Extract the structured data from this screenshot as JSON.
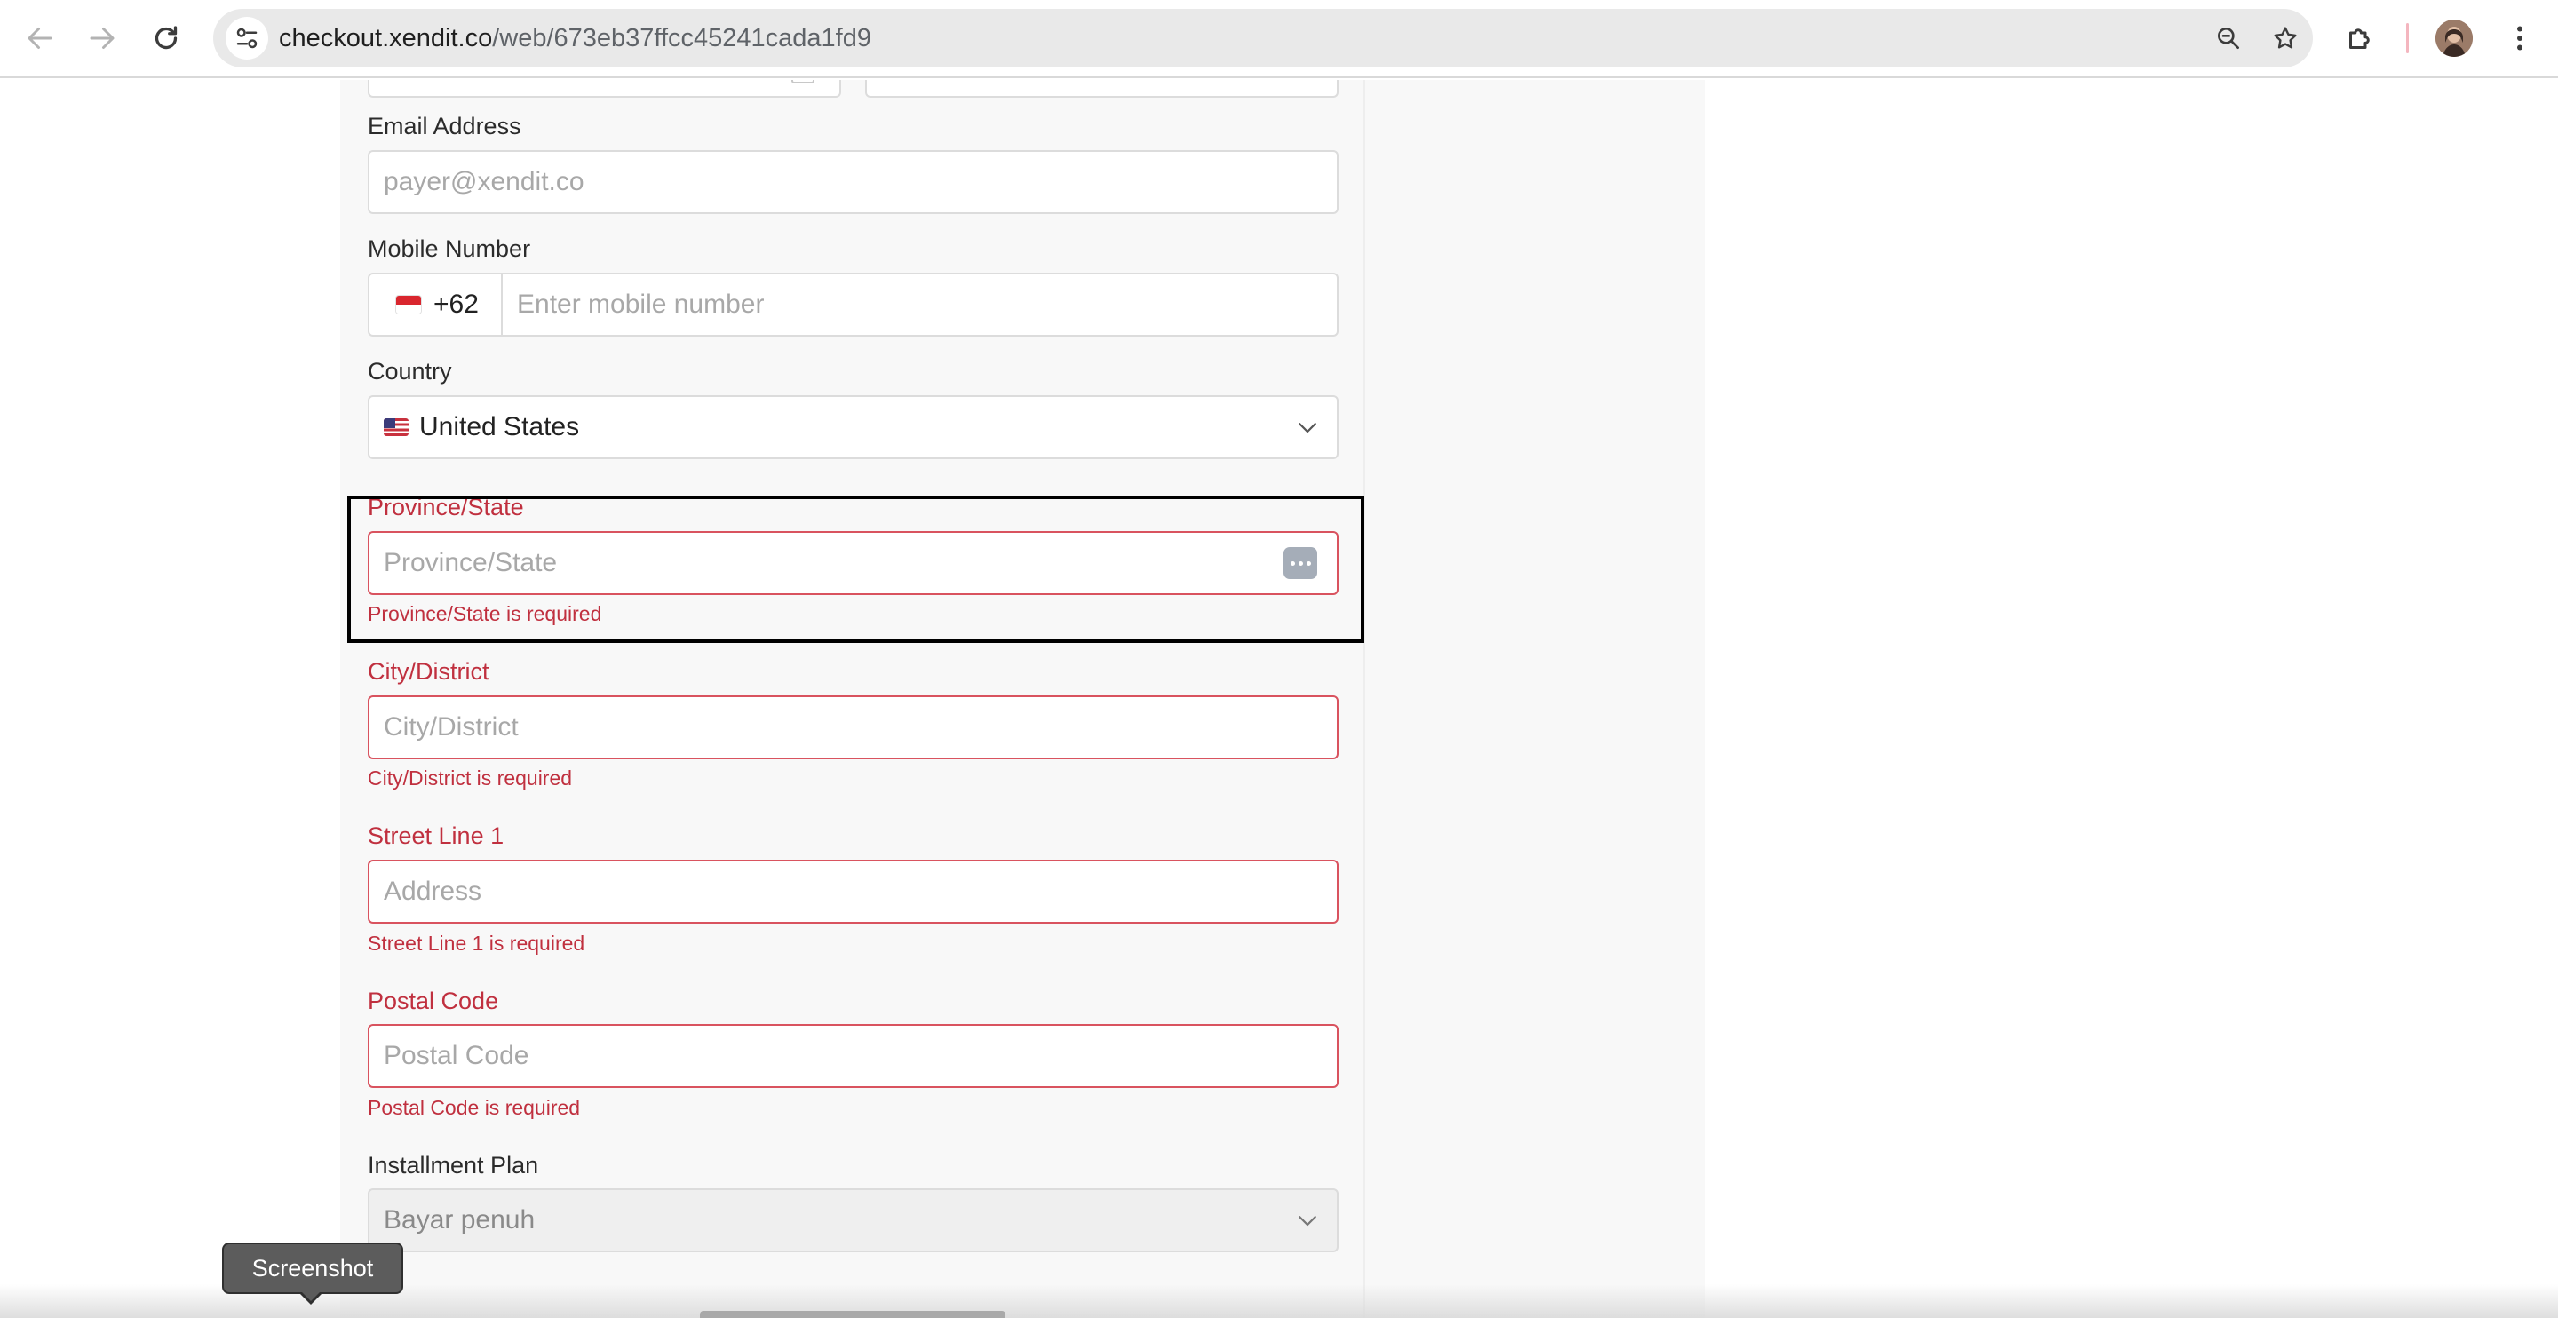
{
  "browser": {
    "url_host": "checkout.xendit.co",
    "url_path": "/web/673eb37ffcc45241cada1fd9",
    "icons": [
      "back-icon",
      "forward-icon",
      "reload-icon",
      "site-info-icon",
      "zoom-icon",
      "bookmark-star-icon",
      "extensions-icon",
      "profile-avatar",
      "more-menu-icon"
    ]
  },
  "form": {
    "email": {
      "label": "Email Address",
      "placeholder": "payer@xendit.co",
      "value": ""
    },
    "mobile": {
      "label": "Mobile Number",
      "country_code": "+62",
      "flag": "indonesia-flag-icon",
      "placeholder": "Enter mobile number",
      "value": ""
    },
    "country": {
      "label": "Country",
      "selected": "United States",
      "flag": "us-flag-icon"
    },
    "province": {
      "label": "Province/State",
      "placeholder": "Province/State",
      "value": "",
      "error": "Province/State is required"
    },
    "city": {
      "label": "City/District",
      "placeholder": "City/District",
      "value": "",
      "error": "City/District is required"
    },
    "street": {
      "label": "Street Line 1",
      "placeholder": "Address",
      "value": "",
      "error": "Street Line 1 is required"
    },
    "postal": {
      "label": "Postal Code",
      "placeholder": "Postal Code",
      "value": "",
      "error": "Postal Code is required"
    },
    "installment": {
      "label": "Installment Plan",
      "selected": "Bayar penuh",
      "disabled": true
    }
  },
  "overlay": {
    "tooltip": "Screenshot"
  },
  "colors": {
    "error": "#c0303f",
    "error_border": "#d9535f",
    "panel_bg": "#f8f8f8",
    "highlight_border": "#000000"
  }
}
